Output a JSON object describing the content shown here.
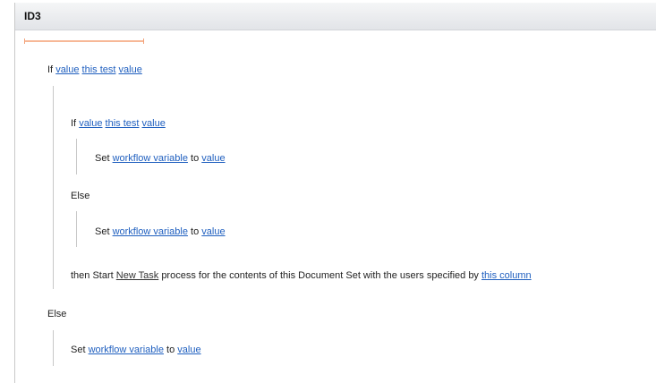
{
  "step": {
    "title": "ID3"
  },
  "block1": {
    "if_kw": "If",
    "left": "value",
    "op": "this test",
    "right": "value"
  },
  "inner_if": {
    "if_kw": "If",
    "left": "value",
    "op": "this test",
    "right": "value"
  },
  "set1": {
    "kw": "Set",
    "var": "workflow variable",
    "to": "to",
    "value": "value"
  },
  "inner_else": {
    "kw": "Else"
  },
  "set2": {
    "kw": "Set",
    "var": "workflow variable",
    "to": "to",
    "value": "value"
  },
  "start_action": {
    "prefix": "then Start",
    "task": "New Task",
    "middle": "process for the contents of this Document Set with the users specified by",
    "column": "this column"
  },
  "outer_else": {
    "kw": "Else"
  },
  "set3": {
    "kw": "Set",
    "var": "workflow variable",
    "to": "to",
    "value": "value"
  }
}
